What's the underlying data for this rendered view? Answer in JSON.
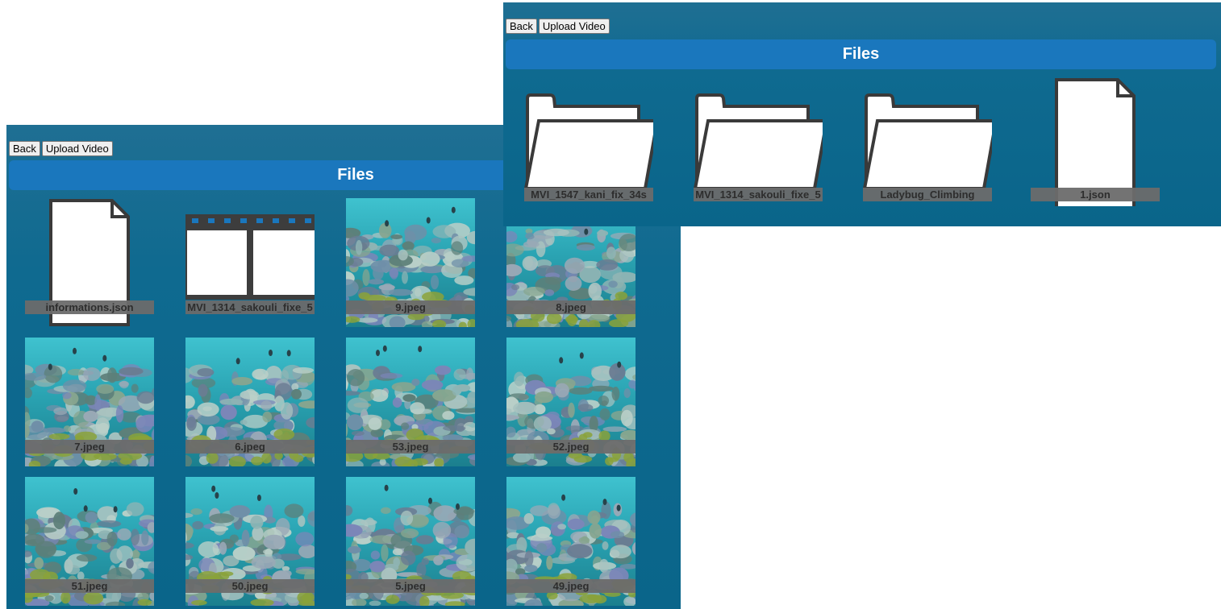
{
  "left_window": {
    "toolbar": {
      "back_label": "Back",
      "upload_label": "Upload Video"
    },
    "header": {
      "title": "Files"
    },
    "items": [
      {
        "name": "informations.json",
        "kind": "file-icon"
      },
      {
        "name": "MVI_1314_sakouli_fixe_5",
        "kind": "video-icon"
      },
      {
        "name": "9.jpeg",
        "kind": "image"
      },
      {
        "name": "8.jpeg",
        "kind": "image"
      },
      {
        "name": "7.jpeg",
        "kind": "image"
      },
      {
        "name": "6.jpeg",
        "kind": "image"
      },
      {
        "name": "53.jpeg",
        "kind": "image"
      },
      {
        "name": "52.jpeg",
        "kind": "image"
      },
      {
        "name": "51.jpeg",
        "kind": "image"
      },
      {
        "name": "50.jpeg",
        "kind": "image"
      },
      {
        "name": "5.jpeg",
        "kind": "image"
      },
      {
        "name": "49.jpeg",
        "kind": "image"
      }
    ]
  },
  "right_window": {
    "toolbar": {
      "back_label": "Back",
      "upload_label": "Upload Video"
    },
    "header": {
      "title": "Files"
    },
    "items": [
      {
        "name": "MVI_1547_kani_fix_34s",
        "kind": "folder-icon"
      },
      {
        "name": "MVI_1314_sakouli_fixe_5",
        "kind": "folder-icon"
      },
      {
        "name": "Ladybug_Climbing",
        "kind": "folder-icon"
      },
      {
        "name": "1.json",
        "kind": "file-icon"
      }
    ]
  },
  "colors": {
    "header_bg": "#1a77bd",
    "panel_bg": "#0a658a",
    "label_bg": "#6c6c6c"
  }
}
